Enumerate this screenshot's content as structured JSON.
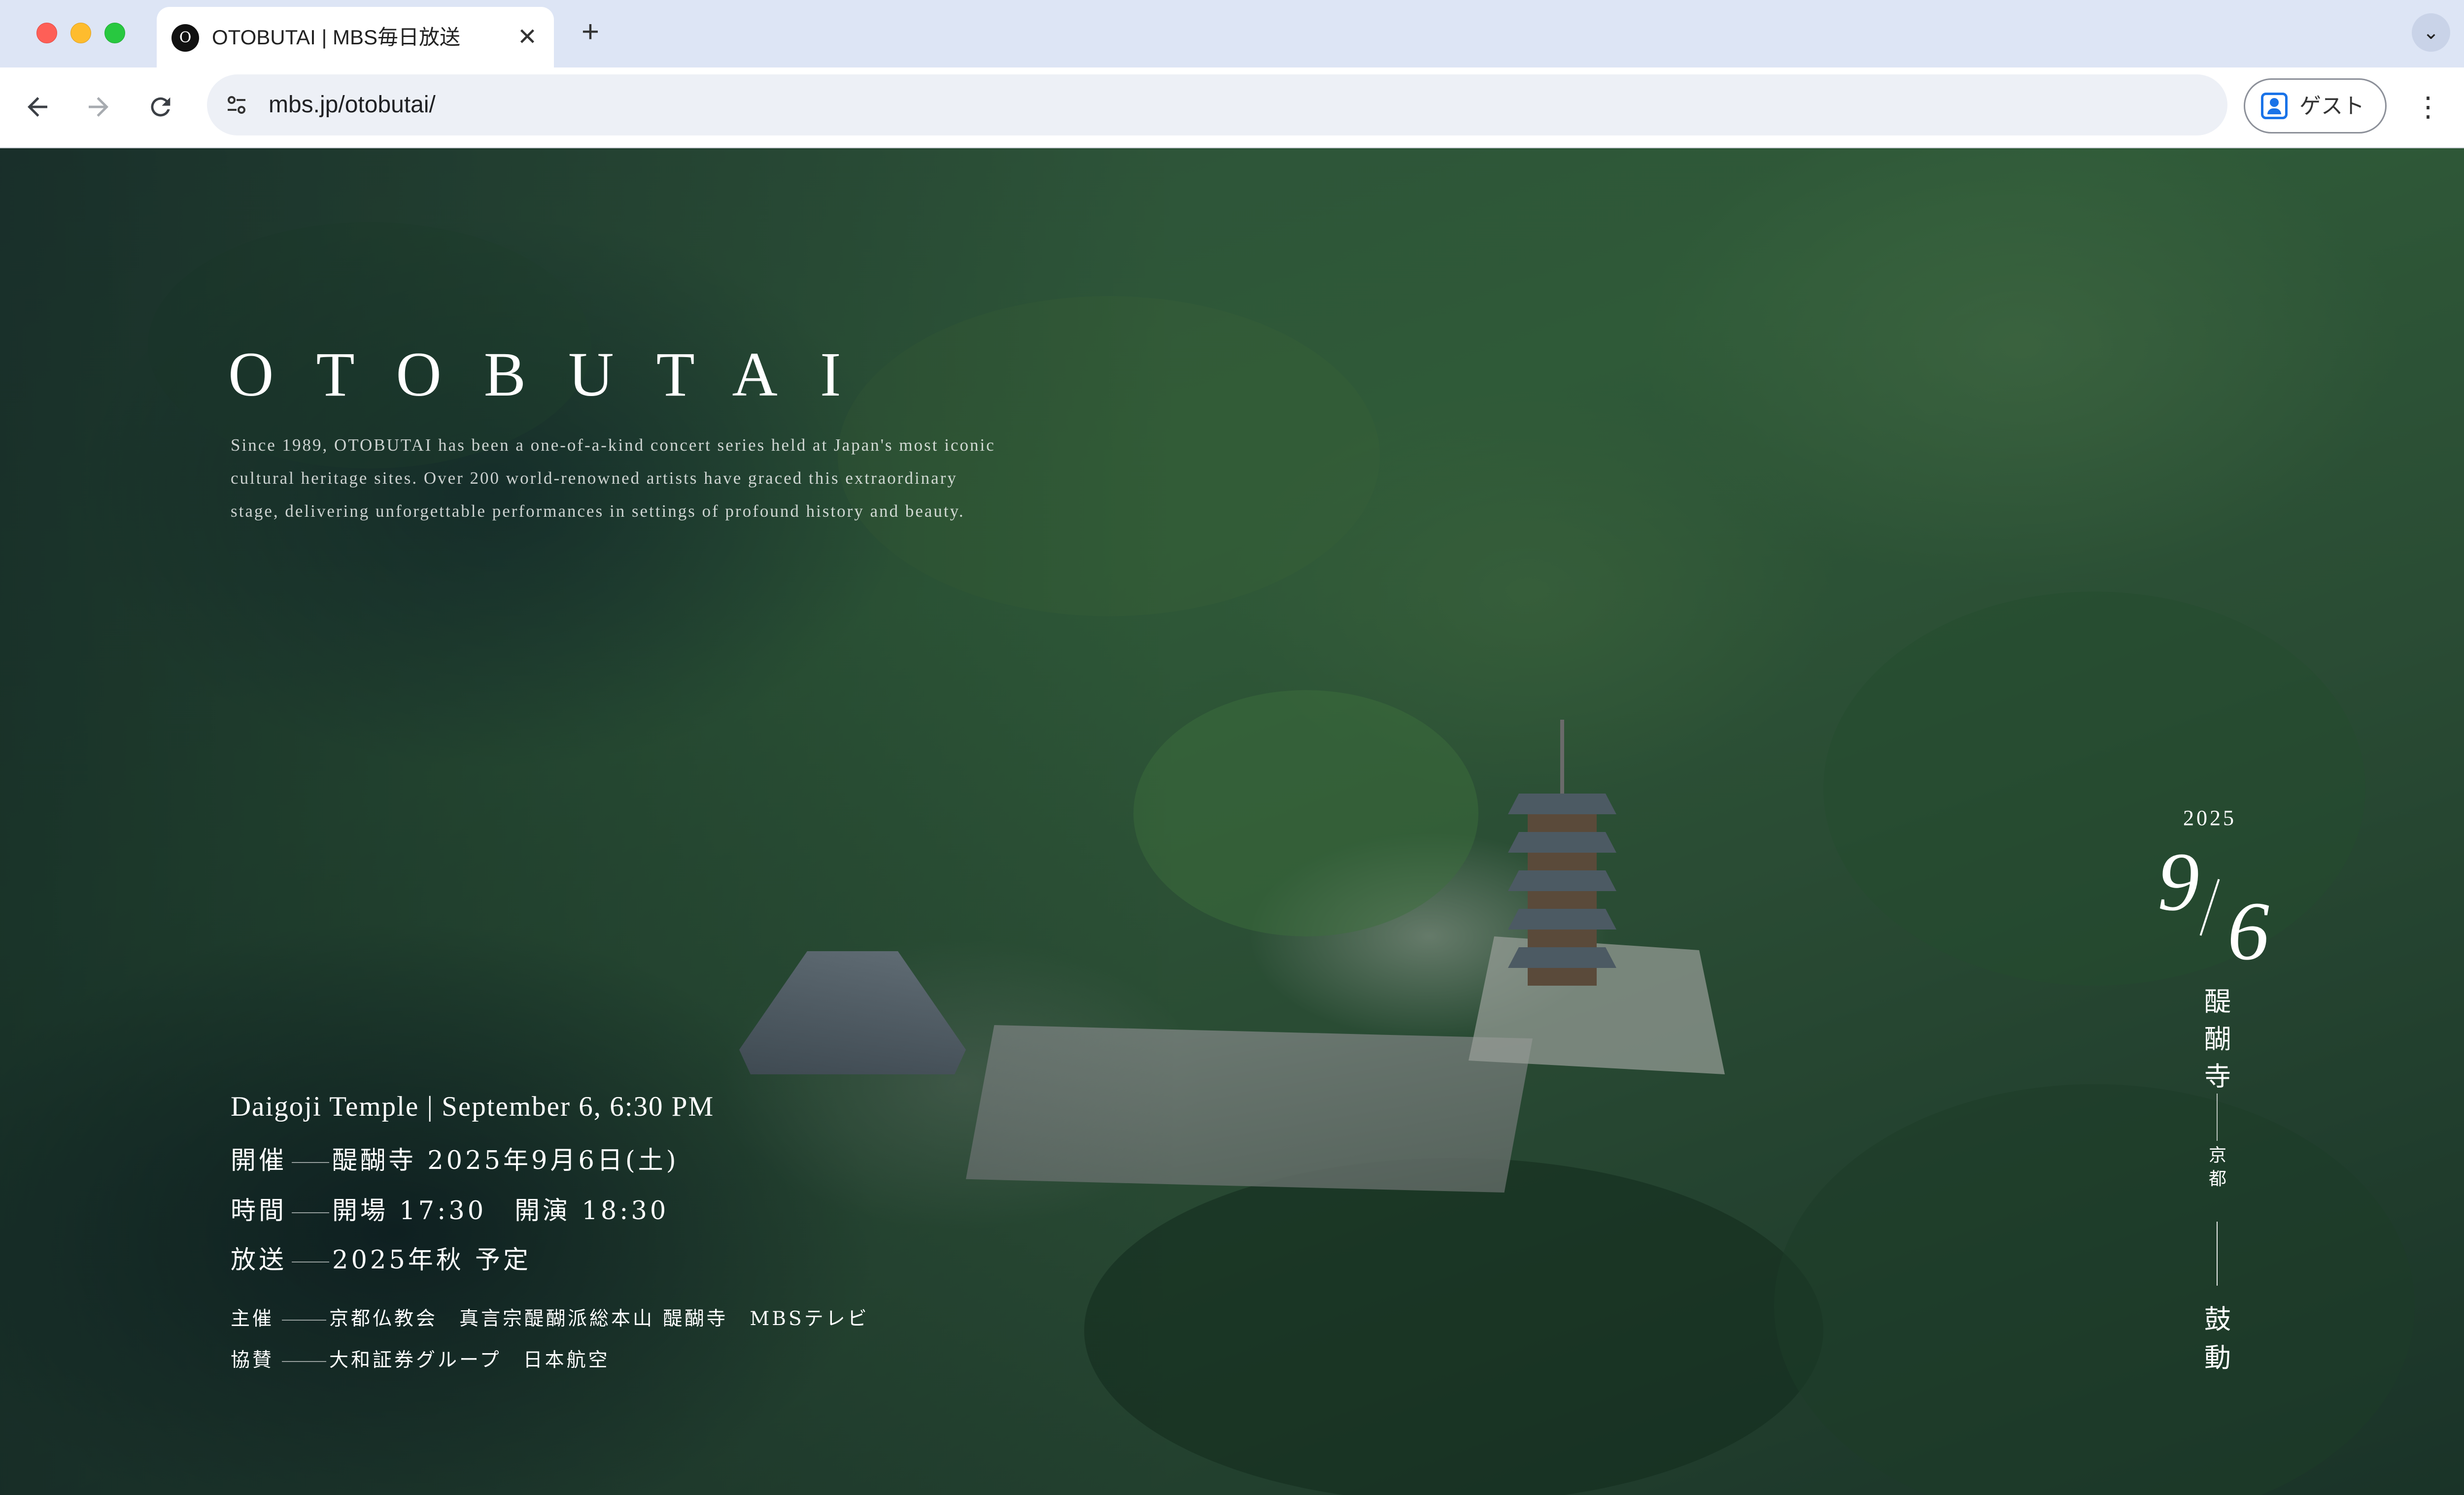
{
  "browser": {
    "tab_title": "OTOBUTAI | MBS毎日放送",
    "favicon_letter": "O",
    "url": "mbs.jp/otobutai/",
    "profile_label": "ゲスト",
    "icons": {
      "back": "arrow-left-icon",
      "forward": "arrow-right-icon",
      "reload": "reload-icon",
      "site_info": "tune-icon",
      "new_tab": "plus-icon",
      "tab_close": "close-icon",
      "tab_menu": "chevron-down-icon",
      "menu": "kebab-icon"
    }
  },
  "hero": {
    "brand": "OTOBUTAI",
    "intro": "Since 1989, OTOBUTAI has been a one-of-a-kind concert series held at Japan's most iconic cultural heritage sites. Over 200 world-renowned artists have graced this extraordinary stage, delivering unforgettable performances in settings of profound history and beauty.",
    "event_line": "Daigoji Temple | September 6, 6:30 PM",
    "info": [
      {
        "label": "開催",
        "value": "醍醐寺 2025年9月6日(土)"
      },
      {
        "label": "時間",
        "value": "開場 17:30　開演 18:30"
      },
      {
        "label": "放送",
        "value": "2025年秋 予定"
      }
    ],
    "credits": [
      {
        "label": "主催",
        "value": "京都仏教会　真言宗醍醐派総本山 醍醐寺　MBSテレビ"
      },
      {
        "label": "協賛",
        "value": "大和証券グループ　日本航空"
      }
    ],
    "date_panel": {
      "year": "2025",
      "month": "9",
      "day": "6",
      "temple": "醍醐寺",
      "city": "京都",
      "theme": "鼓動"
    }
  }
}
